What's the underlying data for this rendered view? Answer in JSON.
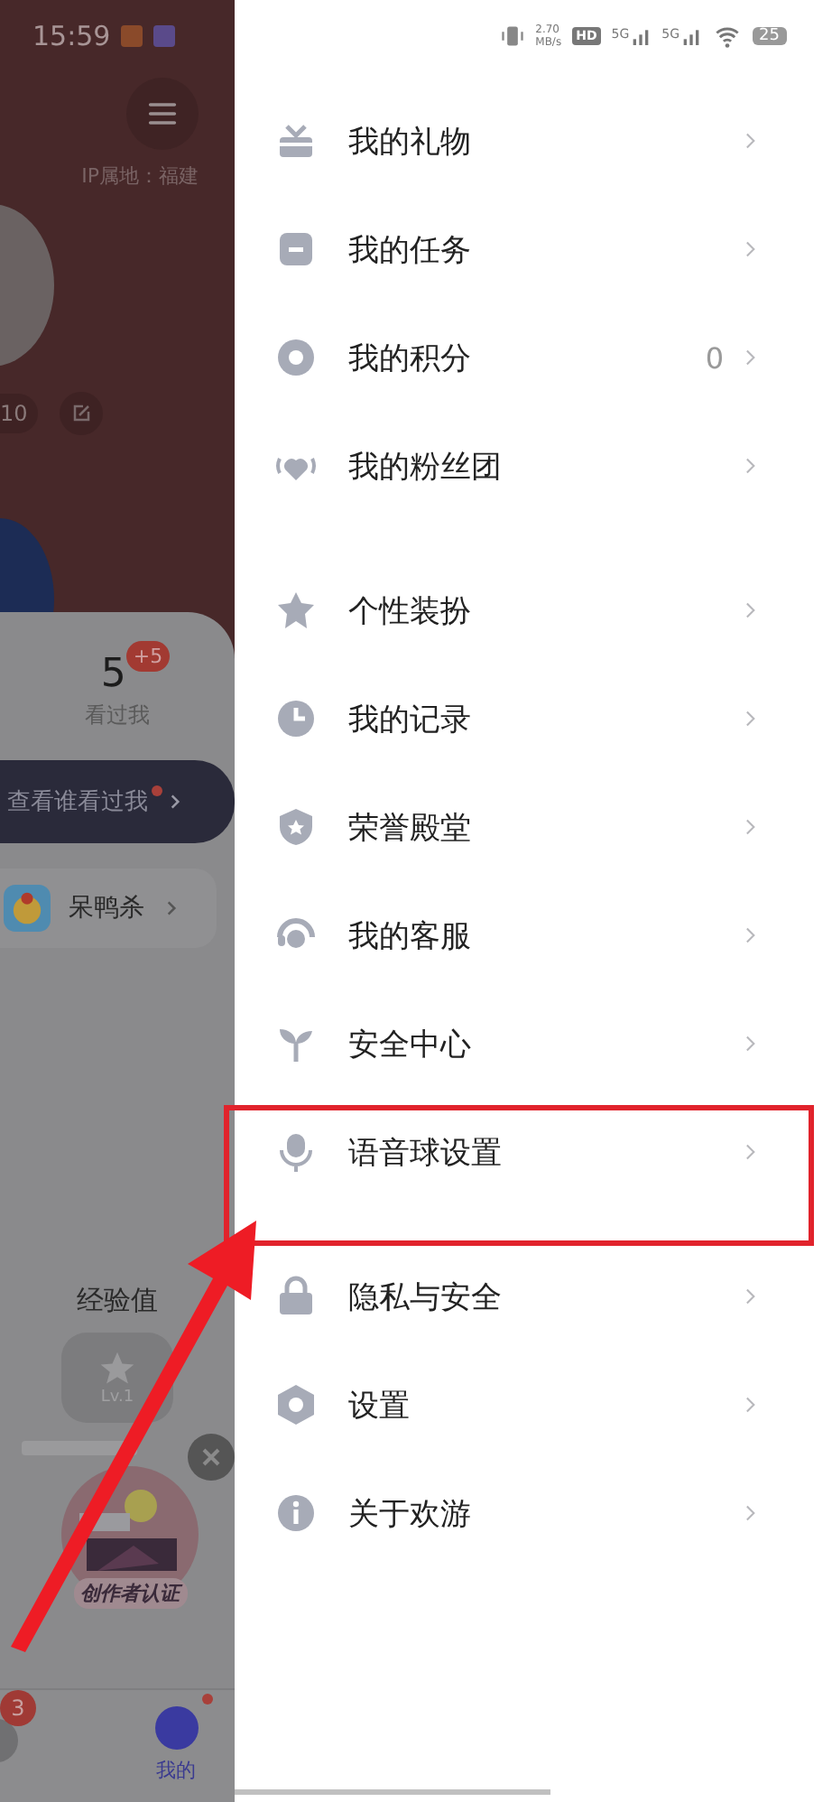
{
  "status_bar": {
    "time": "15:59",
    "speed": "2.70",
    "speed_unit": "MB/s",
    "hd": "HD",
    "networks": [
      "5G",
      "5G"
    ],
    "battery": "25"
  },
  "background_page": {
    "ip_location": "IP属地：福建",
    "level_pill": "10",
    "viewers": {
      "count": "5",
      "badge": "+5",
      "label": "看过我"
    },
    "view_button": "查看谁看过我",
    "game": "呆鸭杀",
    "experience": {
      "title": "经验值",
      "level": "Lv.1"
    },
    "creator_badge": "创作者认证",
    "nav": [
      {
        "badge": "3",
        "selected": false
      },
      {
        "label": "我的",
        "selected": true
      }
    ]
  },
  "drawer": {
    "groups": [
      [
        {
          "label": "我的礼物",
          "annotated": false
        },
        {
          "label": "我的任务",
          "annotated": false
        },
        {
          "label": "我的积分",
          "value": "0",
          "annotated": false
        },
        {
          "label": "我的粉丝团",
          "annotated": false
        }
      ],
      [
        {
          "label": "个性装扮",
          "annotated": false
        },
        {
          "label": "我的记录",
          "annotated": false
        },
        {
          "label": "荣誉殿堂",
          "annotated": false
        },
        {
          "label": "我的客服",
          "annotated": false
        },
        {
          "label": "安全中心",
          "annotated": false
        },
        {
          "label": "语音球设置",
          "annotated": true
        }
      ],
      [
        {
          "label": "隐私与安全",
          "annotated": false
        },
        {
          "label": "设置",
          "annotated": false
        },
        {
          "label": "关于欢游",
          "annotated": false
        }
      ]
    ]
  }
}
